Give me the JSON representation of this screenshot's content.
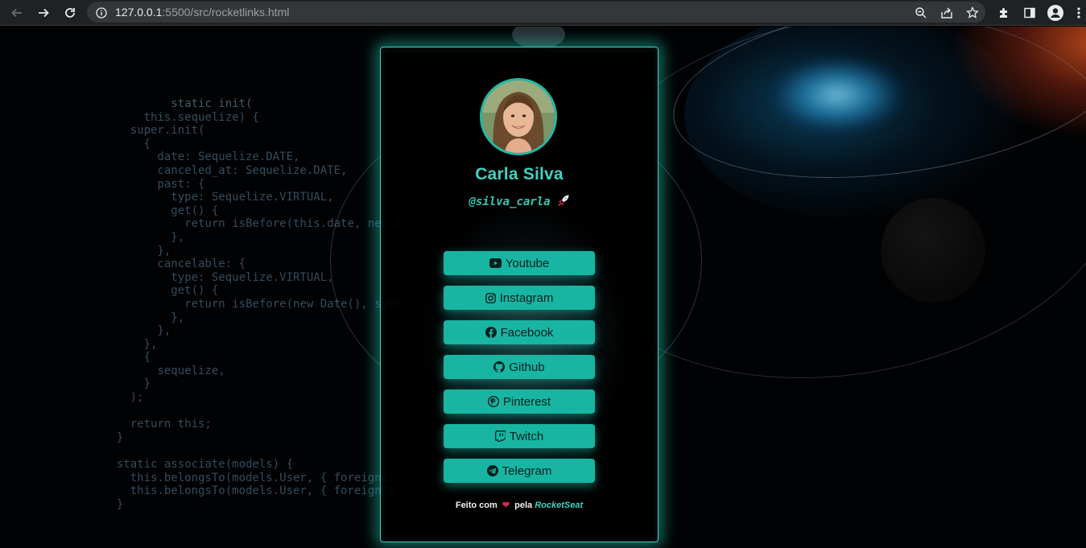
{
  "browser": {
    "url_host": "127.0.0.1",
    "url_path": ":5500/src/rocketlinks.html",
    "icons": [
      "back-icon",
      "forward-icon",
      "reload-icon",
      "info-icon",
      "zoom-icon",
      "share-icon",
      "bookmark-star-icon",
      "extensions-icon",
      "side-panel-icon",
      "profile-icon",
      "menu-icon"
    ]
  },
  "profile": {
    "name": "Carla Silva",
    "handle": "@silva_carla"
  },
  "links": [
    {
      "label": "Youtube",
      "icon": "youtube-icon"
    },
    {
      "label": "Instagram",
      "icon": "instagram-icon"
    },
    {
      "label": "Facebook",
      "icon": "facebook-icon"
    },
    {
      "label": "Github",
      "icon": "github-icon"
    },
    {
      "label": "Pinterest",
      "icon": "pinterest-icon"
    },
    {
      "label": "Twitch",
      "icon": "twitch-icon"
    },
    {
      "label": "Telegram",
      "icon": "telegram-icon"
    }
  ],
  "footer": {
    "prefix": "Feito com",
    "middle": "pela",
    "brand": "RocketSeat"
  },
  "colors": {
    "accent": "#3fd3c0",
    "button": "#18b5a3",
    "heart": "#e0294a"
  }
}
